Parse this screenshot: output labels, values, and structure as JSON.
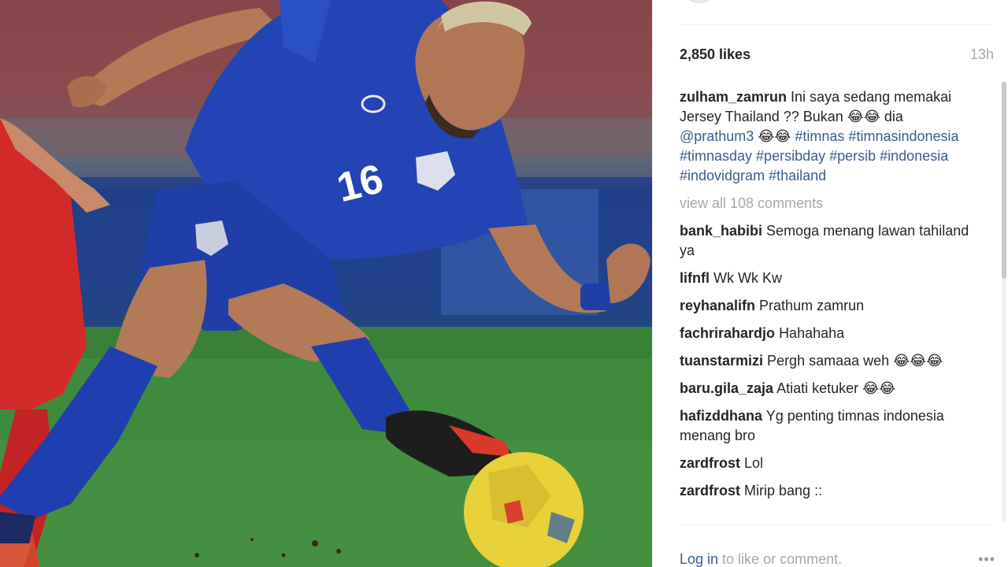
{
  "post": {
    "likes": "2,850 likes",
    "time": "13h",
    "caption": {
      "user": "zulham_zamrun",
      "text_1": "Ini saya sedang memakai Jersey Thailand ?? Bukan 😂😂 dia ",
      "mention": "@prathum3",
      "text_2": " 😂😂 ",
      "hashtags": "#timnas #timnasindonesia #timnasday #persibday #persib #indonesia #indovidgram #thailand"
    },
    "view_all": "view all 108 comments",
    "comments": [
      {
        "user": "bank_habibi",
        "text": "Semoga menang lawan tahiland ya"
      },
      {
        "user": "lifnfl",
        "text": "Wk Wk Kw"
      },
      {
        "user": "reyhanalifn",
        "text": "Prathum zamrun"
      },
      {
        "user": "fachrirahardjo",
        "text": "Hahahaha"
      },
      {
        "user": "tuanstarmizi",
        "text": "Pergh samaaa weh 😂😂😂"
      },
      {
        "user": "baru.gila_zaja",
        "text": "Atiati ketuker 😂😂"
      },
      {
        "user": "hafizddhana",
        "text": "Yg penting timnas indonesia menang bro"
      },
      {
        "user": "zardfrost",
        "text": "Lol"
      },
      {
        "user": "zardfrost",
        "text": "Mirip bang ::"
      }
    ],
    "login_link": "Log in",
    "login_text": " to like or comment.",
    "more_glyph": "•••",
    "jersey_number": "16"
  },
  "colors": {
    "link": "#3a5e8c",
    "muted": "#a8a8a8",
    "jersey": "#2243b3",
    "pitch": "#3f8a3c"
  },
  "icons": [
    "more-options-icon"
  ]
}
